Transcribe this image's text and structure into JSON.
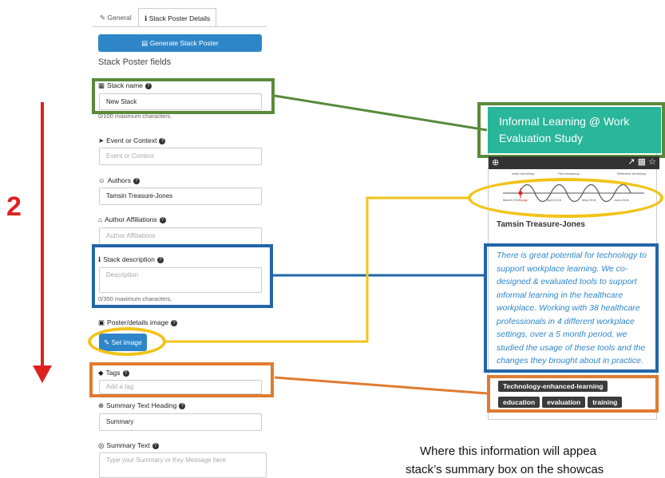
{
  "tabs": [
    {
      "label": "General"
    },
    {
      "label": "Stack Poster Details"
    }
  ],
  "generate_button": "Generate Stack Poster",
  "section_title": "Stack Poster fields",
  "fields": {
    "stack_name": {
      "label": "Stack name",
      "value": "New Stack",
      "hint": "0/100 maximum characters."
    },
    "event": {
      "label": "Event or Context",
      "placeholder": "Event or Context"
    },
    "authors": {
      "label": "Authors",
      "value": "Tamsin Treasure-Jones"
    },
    "affiliations": {
      "label": "Author Affiliations",
      "placeholder": "Author Affiliations"
    },
    "description": {
      "label": "Stack description",
      "placeholder": "Description",
      "hint": "0/350 maximum characters."
    },
    "image": {
      "label": "Poster/details image",
      "button": "Set image"
    },
    "tags": {
      "label": "Tags",
      "placeholder": "Add a tag"
    },
    "summary_heading": {
      "label": "Summary Text Heading",
      "value": "Summary"
    },
    "summary_text": {
      "label": "Summary Text",
      "placeholder": "Type your Summary or Key Message here"
    }
  },
  "step_number": "2",
  "card": {
    "title": "Informal Learning @ Work Evaluation Study",
    "author": "Tamsin Treasure-Jones",
    "timeline_labels": [
      "Initial Workshop",
      "Pilot Workshop",
      "Reflective Workshop",
      "March 2016",
      "Today",
      "April 2016",
      "May 2016",
      "June 2016"
    ],
    "description": "There is great potential for technology to support workplace learning. We co-designed & evaluated tools to support informal learning in the healthcare workplace. Working with 38 healthcare professionals in 4 different workplace settings, over a 5 month period, we studied the usage of these tools and the changes they brought about in practice.",
    "tags": [
      "Technology-enhanced-learning",
      "education",
      "evaluation",
      "training"
    ]
  },
  "bottom_text": [
    "Where this information will appea",
    "stack’s summary box on the showcas"
  ],
  "colors": {
    "green": "#5a8a3a",
    "blue": "#2266a8",
    "orange": "#e07b30",
    "yellow": "#f2c318",
    "red": "#e02020",
    "teal": "#29b69a",
    "primary": "#2e86c9"
  }
}
